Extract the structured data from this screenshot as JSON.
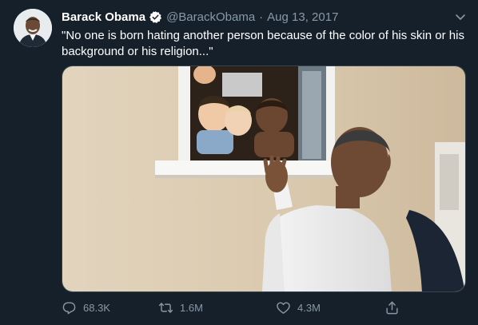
{
  "tweet": {
    "author_name": "Barack Obama",
    "handle": "@BarackObama",
    "separator": "·",
    "date": "Aug 13, 2017",
    "text": "\"No one is born hating another person because of the color of his skin or his background or his religion...\"",
    "verified": true,
    "photo_description": "photo-of-man-at-window-with-children"
  },
  "actions": {
    "reply_count": "68.3K",
    "retweet_count": "1.6M",
    "like_count": "4.3M"
  },
  "icons": {
    "verified": "verified-badge-icon",
    "more": "chevron-down-icon",
    "reply": "reply-icon",
    "retweet": "retweet-icon",
    "like": "heart-icon",
    "share": "share-icon"
  },
  "colors": {
    "background": "#15202b",
    "text_primary": "#ffffff",
    "text_secondary": "#8899a6",
    "verified_badge": "#ffffff"
  }
}
